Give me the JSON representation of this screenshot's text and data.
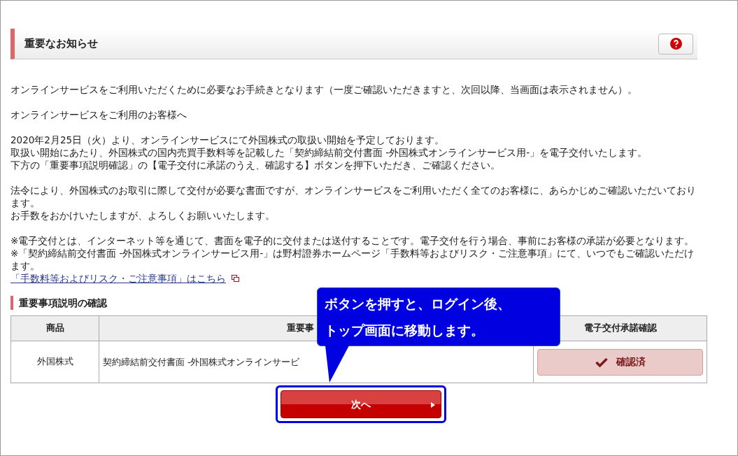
{
  "header": {
    "title": "重要なお知らせ"
  },
  "intro": "オンラインサービスをご利用いただくために必要なお手続きとなります（一度ご確認いただきますと、次回以降、当画面は表示されません）。",
  "greeting": "オンラインサービスをご利用のお客様へ",
  "paragraphs": [
    [
      "2020年2月25日（火）より、オンラインサービスにて外国株式の取扱い開始を予定しております。",
      "取扱い開始にあたり、外国株式の国内売買手数料等を記載した「契約締結前交付書面 -外国株式オンラインサービス用-」を電子交付いたします。",
      "下方の「重要事項説明確認」の【電子交付に承諾のうえ、確認する】ボタンを押下いただき、ご確認ください。"
    ],
    [
      "法令により、外国株式のお取引に際して交付が必要な書面ですが、オンラインサービスをご利用いただく全てのお客様に、あらかじめご確認いただいております。",
      "お手数をおかけいたしますが、よろしくお願いいたします。"
    ],
    [
      "※電子交付とは、インターネット等を通じて、書面を電子的に交付または送付することです。電子交付を行う場合、事前にお客様の承諾が必要となります。",
      "※「契約締結前交付書面 -外国株式オンラインサービス用-」は野村證券ホームページ「手数料等およびリスク・ご注意事項」にて、いつでもご確認いただけます。"
    ]
  ],
  "link": "「手数料等およびリスク・ご注意事項」はこちら",
  "section_title": "重要事項説明の確認",
  "table": {
    "columns": [
      "商品",
      "重要事",
      "電子交付承諾確認"
    ],
    "rows": [
      {
        "product": "外国株式",
        "document": "契約締結前交付書面 -外国株式オンラインサービ",
        "confirm_button": "確認済",
        "confirmed": true
      }
    ]
  },
  "next_button": "次へ",
  "callout": [
    "ボタンを押すと、ログイン後、",
    "トップ画面に移動します。"
  ]
}
